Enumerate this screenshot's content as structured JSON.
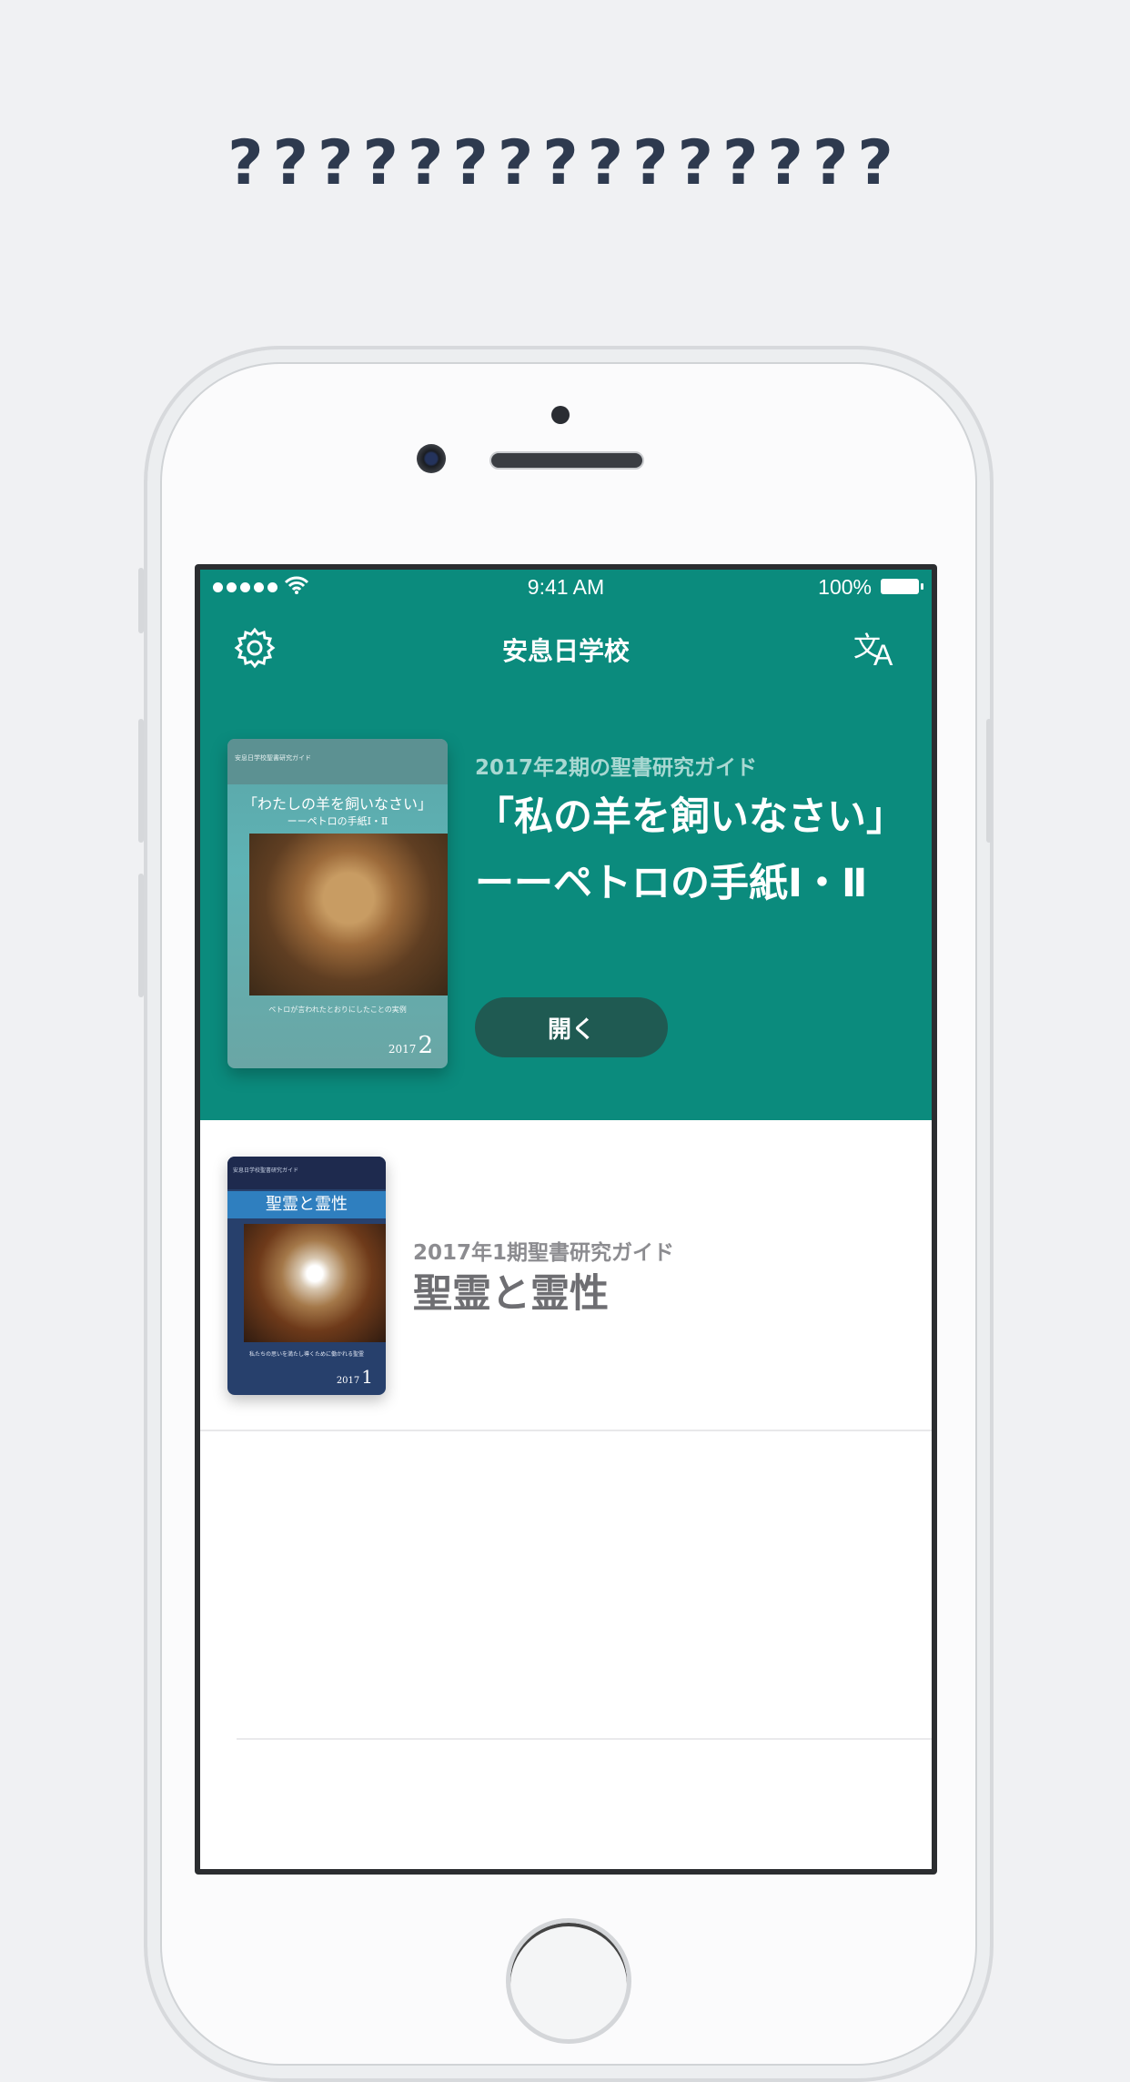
{
  "headline": "???????????????",
  "status_bar": {
    "time": "9:41 AM",
    "battery": "100%"
  },
  "nav": {
    "title": "安息日学校",
    "settings_icon": "gear-icon",
    "language_icon": "translate-icon"
  },
  "featured": {
    "kicker": "2017年2期の聖書研究ガイド",
    "title": "「私の羊を飼いなさい」　ーーペトロの手紙Ⅰ・Ⅱ",
    "open_label": "開く",
    "cover": {
      "band_text": "安息日学校聖書研究ガイド",
      "title": "「わたしの羊を飼いなさい」",
      "subtitle": "ーーペトロの手紙Ⅰ・Ⅱ",
      "caption": "ペトロが言われたとおりにしたことの実例",
      "year": "2017",
      "quarter": "2"
    }
  },
  "list": [
    {
      "kicker": "2017年1期聖書研究ガイド",
      "title": "聖霊と霊性",
      "cover": {
        "band_text": "安息日学校聖書研究ガイド",
        "title": "聖霊と霊性",
        "caption": "私たちの思いを満たし導くために働かれる聖霊",
        "year": "2017",
        "quarter": "1"
      }
    }
  ],
  "colors": {
    "accent": "#0b8b7d",
    "button": "#1f5a52",
    "headline": "#2e3a4f"
  }
}
